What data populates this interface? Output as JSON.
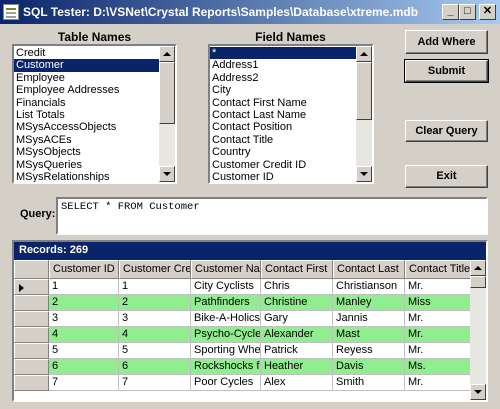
{
  "window": {
    "title": "SQL Tester: D:\\VSNet\\Crystal Reports\\Samples\\Database\\xtreme.mdb",
    "buttons": {
      "minimize": "_",
      "maximize": "□",
      "close": "✕"
    }
  },
  "table_names": {
    "label": "Table Names",
    "items": [
      "Credit",
      "Customer",
      "Employee",
      "Employee Addresses",
      "Financials",
      "List Totals",
      "MSysAccessObjects",
      "MSysACEs",
      "MSysObjects",
      "MSysQueries",
      "MSysRelationships"
    ],
    "selected_index": 1
  },
  "field_names": {
    "label": "Field Names",
    "items": [
      "*",
      "Address1",
      "Address2",
      "City",
      "Contact First Name",
      "Contact Last Name",
      "Contact Position",
      "Contact Title",
      "Country",
      "Customer Credit ID",
      "Customer ID"
    ],
    "selected_index": 0
  },
  "buttons": {
    "add_where": "Add Where",
    "submit": "Submit",
    "clear_query": "Clear Query",
    "exit": "Exit"
  },
  "query": {
    "label": "Query:",
    "value": "SELECT *  FROM Customer"
  },
  "grid": {
    "records_label": "Records: 269",
    "columns": [
      "Customer ID",
      "Customer Cre",
      "Customer Na",
      "Contact First",
      "Contact Last",
      "Contact Title"
    ],
    "rows": [
      [
        "1",
        "1",
        "City Cyclists",
        "Chris",
        "Christianson",
        "Mr."
      ],
      [
        "2",
        "2",
        "Pathfinders",
        "Christine",
        "Manley",
        "Miss"
      ],
      [
        "3",
        "3",
        "Bike-A-Holics",
        "Gary",
        "Jannis",
        "Mr."
      ],
      [
        "4",
        "4",
        "Psycho-Cycle",
        "Alexander",
        "Mast",
        "Mr."
      ],
      [
        "5",
        "5",
        "Sporting Whe",
        "Patrick",
        "Reyess",
        "Mr."
      ],
      [
        "6",
        "6",
        "Rockshocks f",
        "Heather",
        "Davis",
        "Ms."
      ],
      [
        "7",
        "7",
        "Poor Cycles",
        "Alex",
        "Smith",
        "Mr."
      ]
    ],
    "colors": {
      "alt_row": "#90ee90",
      "row": "#ffffff",
      "header_bar": "#0a246a"
    }
  }
}
